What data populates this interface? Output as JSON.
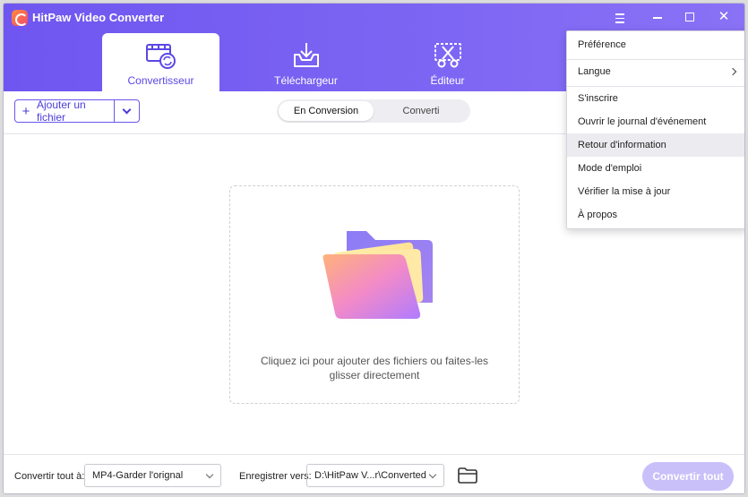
{
  "app": {
    "title": "HitPaw Video Converter"
  },
  "tabs": [
    {
      "label": "Convertisseur",
      "icon": "film-convert-icon",
      "active": true
    },
    {
      "label": "Téléchargeur",
      "icon": "download-tray-icon",
      "active": false
    },
    {
      "label": "Éditeur",
      "icon": "scissors-icon",
      "active": false
    }
  ],
  "toolbar": {
    "add_file_label": "Ajouter un fichier",
    "segments": [
      {
        "label": "En Conversion",
        "active": true
      },
      {
        "label": "Converti",
        "active": false
      }
    ]
  },
  "drop_zone": {
    "text": "Cliquez ici pour ajouter des fichiers ou faites-les glisser directement"
  },
  "footer": {
    "convert_all_label": "Convertir tout à:",
    "convert_all_value": "MP4-Garder l'orignal",
    "save_label": "Enregistrer vers:",
    "save_value": "D:\\HitPaw V...r\\Converted",
    "convert_button": "Convertir tout"
  },
  "menu": {
    "items": [
      {
        "label": "Préférence"
      },
      {
        "label": "Langue",
        "submenu": true
      },
      {
        "label": "S'inscrire"
      },
      {
        "label": "Ouvrir le journal d'événement"
      },
      {
        "label": "Retour d'information",
        "hover": true
      },
      {
        "label": "Mode d'emploi"
      },
      {
        "label": "Vérifier la mise à jour"
      },
      {
        "label": "À propos"
      }
    ]
  },
  "colors": {
    "accent": "#6f56f0",
    "accent_text": "#5b47e6",
    "disabled_button": "#c9c0fa"
  }
}
